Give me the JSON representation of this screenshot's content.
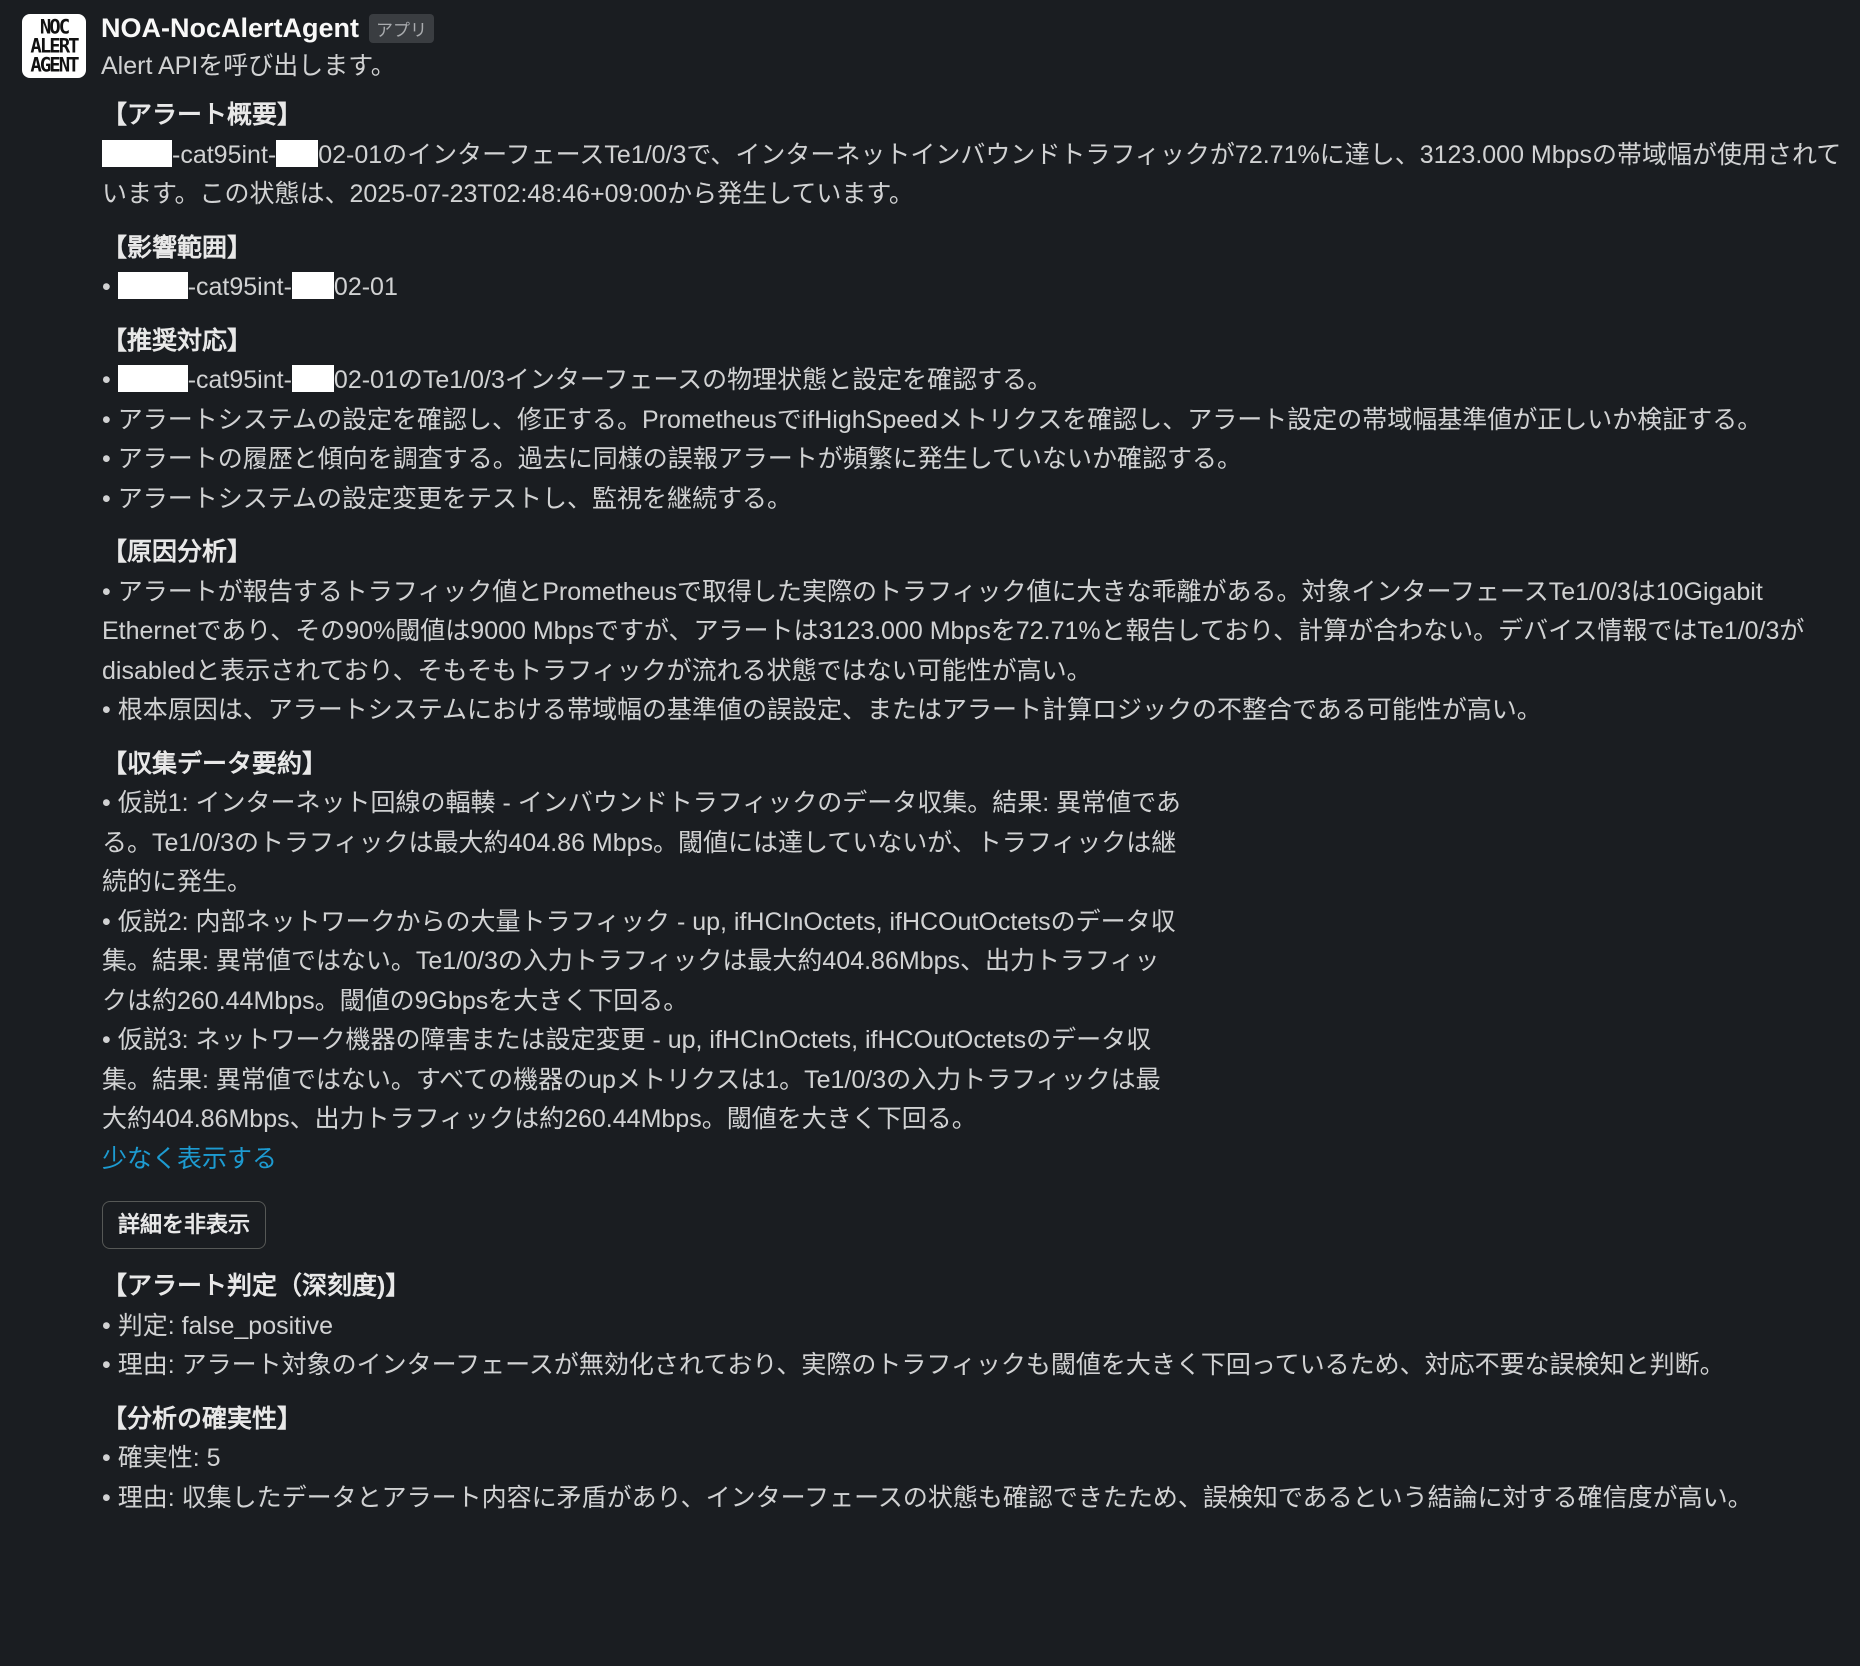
{
  "message": {
    "sender": "NOA-NocAlertAgent",
    "badge": "アプリ",
    "avatar_lines": [
      "NOC",
      "ALERT",
      "AGENT"
    ],
    "intro": "Alert APIを呼び出します。"
  },
  "summary": {
    "title": "【アラート概要】",
    "text_1": "-cat95int-",
    "text_2": "02-01のインターフェースTe1/0/3で、インターネットインバウンドトラフィックが72.71%に達し、3123.000 Mbpsの帯域幅が使用されています。この状態は、2025-07-23T02:48:46+09:00から発生しています。"
  },
  "impact": {
    "title": "【影響範囲】",
    "items": [
      {
        "a": "-cat95int-",
        "b": "02-01"
      }
    ]
  },
  "recommend": {
    "title": "【推奨対応】",
    "item1_a": "-cat95int-",
    "item1_b": "02-01のTe1/0/3インターフェースの物理状態と設定を確認する。",
    "items": [
      "• アラートシステムの設定を確認し、修正する。PrometheusでifHighSpeedメトリクスを確認し、アラート設定の帯域幅基準値が正しいか検証する。",
      "• アラートの履歴と傾向を調査する。過去に同様の誤報アラートが頻繁に発生していないか確認する。",
      "• アラートシステムの設定変更をテストし、監視を継続する。"
    ]
  },
  "cause": {
    "title": "【原因分析】",
    "items": [
      "• アラートが報告するトラフィック値とPrometheusで取得した実際のトラフィック値に大きな乖離がある。対象インターフェースTe1/0/3は10Gigabit Ethernetであり、その90%閾値は9000 Mbpsですが、アラートは3123.000 Mbpsを72.71%と報告しており、計算が合わない。デバイス情報ではTe1/0/3がdisabledと表示されており、そもそもトラフィックが流れる状態ではない可能性が高い。",
      "• 根本原因は、アラートシステムにおける帯域幅の基準値の誤設定、またはアラート計算ロジックの不整合である可能性が高い。"
    ]
  },
  "collected": {
    "title": "【収集データ要約】",
    "items": [
      "• 仮説1: インターネット回線の輻輳 - インバウンドトラフィックのデータ収集。結果: 異常値である。Te1/0/3のトラフィックは最大約404.86 Mbps。閾値には達していないが、トラフィックは継続的に発生。",
      "• 仮説2: 内部ネットワークからの大量トラフィック - up, ifHCInOctets, ifHCOutOctetsのデータ収集。結果: 異常値ではない。Te1/0/3の入力トラフィックは最大約404.86Mbps、出力トラフィックは約260.44Mbps。閾値の9Gbpsを大きく下回る。",
      "• 仮説3: ネットワーク機器の障害または設定変更 - up, ifHCInOctets, ifHCOutOctetsのデータ収集。結果: 異常値ではない。すべての機器のupメトリクスは1。Te1/0/3の入力トラフィックは最大約404.86Mbps、出力トラフィックは約260.44Mbps。閾値を大きく下回る。"
    ],
    "show_less": "少なく表示する"
  },
  "details_button": "詳細を非表示",
  "verdict": {
    "title": "【アラート判定（深刻度)】",
    "items": [
      "• 判定: false_positive",
      "• 理由: アラート対象のインターフェースが無効化されており、実際のトラフィックも閾値を大きく下回っているため、対応不要な誤検知と判断。"
    ]
  },
  "certainty": {
    "title": "【分析の確実性】",
    "items": [
      "• 確実性: 5",
      "• 理由: 収集したデータとアラート内容に矛盾があり、インターフェースの状態も確認できたため、誤検知であるという結論に対する確信度が高い。"
    ]
  }
}
